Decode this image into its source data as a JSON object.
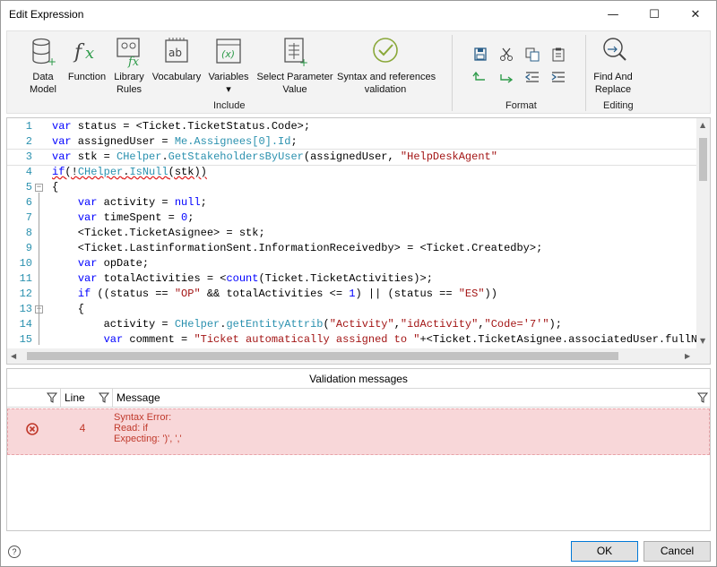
{
  "window": {
    "title": "Edit Expression",
    "minimize": "—",
    "maximize": "☐",
    "close": "✕"
  },
  "ribbon": {
    "include_group": {
      "label": "Include",
      "buttons": [
        {
          "label": "Data\nModel",
          "icon": "database-icon"
        },
        {
          "label": "Function",
          "icon": "function-icon"
        },
        {
          "label": "Library\nRules",
          "icon": "library-rules-icon"
        },
        {
          "label": "Vocabulary",
          "icon": "vocabulary-icon"
        },
        {
          "label": "Variables",
          "icon": "variables-icon"
        },
        {
          "label": "Select Parameter\nValue",
          "icon": "select-parameter-icon"
        },
        {
          "label": "Syntax and references\nvalidation",
          "icon": "validation-check-icon"
        }
      ],
      "variables_dropdown": "▾"
    },
    "format_group": {
      "label": "Format",
      "icons": [
        "save-icon",
        "cut-icon",
        "copy-icon",
        "paste-icon",
        "undo-icon",
        "redo-icon",
        "outdent-icon",
        "indent-icon"
      ]
    },
    "editing_group": {
      "label": "Editing",
      "find_replace": "Find And\nReplace",
      "icon": "find-replace-icon"
    }
  },
  "editor": {
    "lines": [
      {
        "n": "1",
        "fold": "",
        "tokens": [
          [
            "kw",
            "var"
          ],
          [
            "plain",
            " status = <Ticket.TicketStatus.Code>;"
          ]
        ]
      },
      {
        "n": "2",
        "fold": "",
        "tokens": [
          [
            "kw",
            "var"
          ],
          [
            "plain",
            " assignedUser = "
          ],
          [
            "mem",
            "Me.Assignees[0].Id"
          ],
          [
            "plain",
            ";"
          ]
        ]
      },
      {
        "n": "3",
        "fold": "",
        "tokens": [
          [
            "kw",
            "var"
          ],
          [
            "plain",
            " stk = "
          ],
          [
            "mem",
            "CHelper"
          ],
          [
            "plain",
            "."
          ],
          [
            "mem",
            "GetStakeholdersByUser"
          ],
          [
            "plain",
            "(assignedUser, "
          ],
          [
            "str",
            "\"HelpDeskAgent\""
          ]
        ]
      },
      {
        "n": "4",
        "fold": "",
        "tokens": [
          [
            "kw",
            "if"
          ],
          [
            "plain",
            "(!"
          ],
          [
            "mem",
            "CHelper"
          ],
          [
            "plain",
            "."
          ],
          [
            "mem",
            "IsNull"
          ],
          [
            "plain",
            "(stk))"
          ]
        ]
      },
      {
        "n": "5",
        "fold": "−",
        "tokens": [
          [
            "plain",
            "{"
          ]
        ]
      },
      {
        "n": "6",
        "fold": "",
        "tokens": [
          [
            "plain",
            "    "
          ],
          [
            "kw",
            "var"
          ],
          [
            "plain",
            " activity = "
          ],
          [
            "kw",
            "null"
          ],
          [
            "plain",
            ";"
          ]
        ]
      },
      {
        "n": "7",
        "fold": "",
        "tokens": [
          [
            "plain",
            "    "
          ],
          [
            "kw",
            "var"
          ],
          [
            "plain",
            " timeSpent = "
          ],
          [
            "kw",
            "0"
          ],
          [
            "plain",
            ";"
          ]
        ]
      },
      {
        "n": "8",
        "fold": "",
        "tokens": [
          [
            "plain",
            "    <Ticket.TicketAsignee> = stk;"
          ]
        ]
      },
      {
        "n": "9",
        "fold": "",
        "tokens": [
          [
            "plain",
            "    <Ticket.LastinformationSent.InformationReceivedby> = <Ticket.Createdby>;"
          ]
        ]
      },
      {
        "n": "10",
        "fold": "",
        "tokens": [
          [
            "plain",
            "    "
          ],
          [
            "kw",
            "var"
          ],
          [
            "plain",
            " opDate;"
          ]
        ]
      },
      {
        "n": "11",
        "fold": "",
        "tokens": [
          [
            "plain",
            "    "
          ],
          [
            "kw",
            "var"
          ],
          [
            "plain",
            " totalActivities = <"
          ],
          [
            "kw",
            "count"
          ],
          [
            "plain",
            "(Ticket.TicketActivities)>;"
          ]
        ]
      },
      {
        "n": "12",
        "fold": "",
        "tokens": [
          [
            "plain",
            "    "
          ],
          [
            "kw",
            "if"
          ],
          [
            "plain",
            " ((status == "
          ],
          [
            "str",
            "\"OP\""
          ],
          [
            "plain",
            " && totalActivities <= "
          ],
          [
            "kw",
            "1"
          ],
          [
            "plain",
            ") || (status == "
          ],
          [
            "str",
            "\"ES\""
          ],
          [
            "plain",
            "))"
          ]
        ]
      },
      {
        "n": "13",
        "fold": "−",
        "tokens": [
          [
            "plain",
            "    {"
          ]
        ]
      },
      {
        "n": "14",
        "fold": "",
        "tokens": [
          [
            "plain",
            "        activity = "
          ],
          [
            "mem",
            "CHelper"
          ],
          [
            "plain",
            "."
          ],
          [
            "mem",
            "getEntityAttrib"
          ],
          [
            "plain",
            "("
          ],
          [
            "str",
            "\"Activity\""
          ],
          [
            "plain",
            ","
          ],
          [
            "str",
            "\"idActivity\""
          ],
          [
            "plain",
            ","
          ],
          [
            "str",
            "\"Code='7'\""
          ],
          [
            "plain",
            ");"
          ]
        ]
      },
      {
        "n": "15",
        "fold": "",
        "tokens": [
          [
            "plain",
            "        "
          ],
          [
            "kw",
            "var"
          ],
          [
            "plain",
            " comment = "
          ],
          [
            "str",
            "\"Ticket automatically assigned to \""
          ],
          [
            "plain",
            "+<Ticket.TicketAsignee.associatedUser.fullName"
          ]
        ]
      }
    ]
  },
  "validation": {
    "title": "Validation messages",
    "columns": {
      "line": "Line",
      "message": "Message"
    },
    "rows": [
      {
        "line": "4",
        "message": [
          "Syntax Error:",
          "Read: if",
          "Expecting: ')', ','"
        ]
      }
    ]
  },
  "footer": {
    "help": "?",
    "ok": "OK",
    "cancel": "Cancel"
  },
  "colors": {
    "error_row_bg": "#f8d7d9",
    "error_text": "#c0392b",
    "keyword": "#0000ff",
    "string": "#a31515",
    "member": "#2b91af"
  }
}
